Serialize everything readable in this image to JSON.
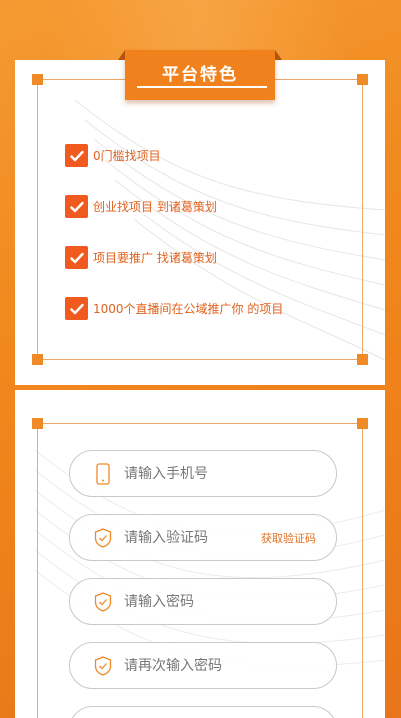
{
  "features_section": {
    "title": "平台特色",
    "items": [
      {
        "text": "0门槛找项目"
      },
      {
        "text": "创业找项目 到诸葛策划"
      },
      {
        "text": "项目要推广 找诸葛策划"
      },
      {
        "text": "1000个直播间在公域推广你 的项目"
      }
    ]
  },
  "form": {
    "phone_placeholder": "请输入手机号",
    "code_placeholder": "请输入验证码",
    "get_code_label": "获取验证码",
    "password_placeholder": "请输入密码",
    "confirm_password_placeholder": "请再次输入密码"
  },
  "colors": {
    "accent": "#f0811c",
    "check_bg": "#f05a1e",
    "feature_text": "#e0621f"
  }
}
